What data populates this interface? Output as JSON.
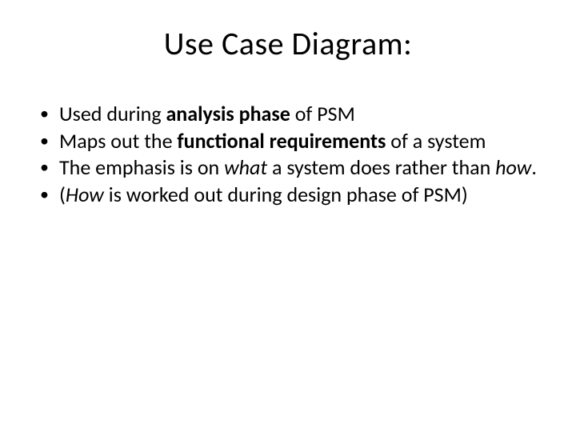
{
  "title": "Use Case Diagram:",
  "bullets": [
    {
      "pre": "Used during ",
      "emph": "analysis phase",
      "emphClass": "bold",
      "post": " of PSM"
    },
    {
      "pre": "Maps out the ",
      "emph": "functional requirements",
      "emphClass": "bold",
      "post": " of a system"
    },
    {
      "pre": "The emphasis is on ",
      "emph": "what",
      "emphClass": "italic",
      "mid": " a system does rather than ",
      "emph2": "how",
      "emph2Class": "italic",
      "post": "."
    },
    {
      "pre": "(",
      "emph": "How",
      "emphClass": "italic",
      "post": " is worked out during design phase of PSM)"
    }
  ]
}
